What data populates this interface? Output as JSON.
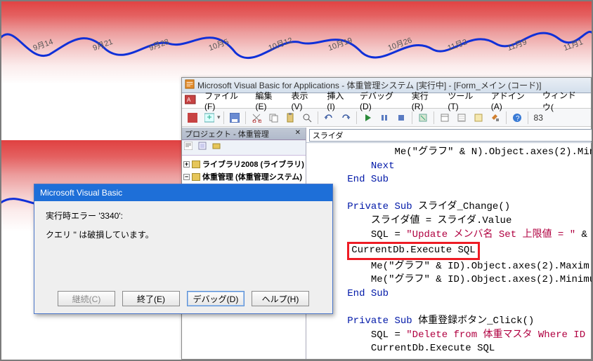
{
  "graph": {
    "dates": [
      "9月14",
      "9月21",
      "9月28",
      "10月5",
      "10月12",
      "10月19",
      "10月26",
      "11月2",
      "11月9",
      "11月1"
    ]
  },
  "vba": {
    "title": "Microsoft Visual Basic for Applications - 体重管理システム [実行中] - [Form_メイン (コード)]",
    "menus": [
      "ファイル(F)",
      "編集(E)",
      "表示(V)",
      "挿入(I)",
      "デバッグ(D)",
      "実行(R)",
      "ツール(T)",
      "アドイン(A)",
      "ウィンドウ("
    ],
    "toolbar_line_col": "83",
    "project": {
      "panel_title": "プロジェクト - 体重管理",
      "items": [
        "ライブラリ2008 (ライブラリ)",
        "体重管理 (体重管理システム)"
      ]
    },
    "code": {
      "dropdown1": "スライダ",
      "lines": {
        "l1": "              Me(\"グラフ\" & N).Object.axes(2).Mini",
        "l2": "          Next",
        "l3": "      End Sub",
        "l4": "",
        "l5a": "      Private Sub",
        "l5b": " スライダ_Change()",
        "l6": "          スライダ値 = スライダ.Value",
        "l7a": "          SQL = ",
        "l7b": "\"Update メンバ名 Set 上限値 = \"",
        "l7c": " &",
        "l8": "CurrentDb.Execute SQL",
        "l9": "          Me(\"グラフ\" & ID).Object.axes(2).Maxim",
        "l10": "          Me(\"グラフ\" & ID).Object.axes(2).Minimu",
        "l11": "      End Sub",
        "l12": "",
        "l13a": "      Private Sub",
        "l13b": " 体重登録ボタン_Click()",
        "l14a": "          SQL = ",
        "l14b": "\"Delete from 体重マスタ Where ID",
        "l15": "          CurrentDb.Execute SQL"
      }
    }
  },
  "dialog": {
    "title": "Microsoft Visual Basic",
    "err_code": "実行時エラー '3340':",
    "err_msg": "クエリ '' は破損しています。",
    "buttons": {
      "continue": "継続(C)",
      "end": "終了(E)",
      "debug": "デバッグ(D)",
      "help": "ヘルプ(H)"
    }
  }
}
